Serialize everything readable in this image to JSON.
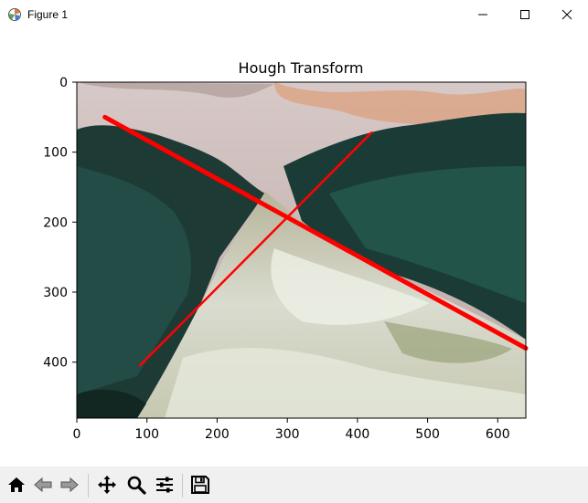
{
  "window": {
    "title": "Figure 1",
    "icons": [
      "matplotlib-figure-icon",
      "minimize-icon",
      "maximize-icon",
      "close-icon"
    ]
  },
  "figure": {
    "title": "Hough Transform"
  },
  "chart_data": {
    "type": "image",
    "title": "Hough Transform",
    "xlabel": "",
    "ylabel": "",
    "xlim": [
      0,
      640
    ],
    "ylim": [
      480,
      0
    ],
    "x_ticks": [
      "0",
      "100",
      "200",
      "300",
      "400",
      "500",
      "600"
    ],
    "y_ticks": [
      "0",
      "100",
      "200",
      "300",
      "400"
    ],
    "grid": false,
    "image_content": "photo of a white-water river between tree-lined banks under a cloudy sky",
    "overlay_lines": [
      {
        "color": "#ff0000",
        "x1": 40,
        "y1": 50,
        "x2": 640,
        "y2": 380
      },
      {
        "color": "#ff0000",
        "x1": 90,
        "y1": 405,
        "x2": 420,
        "y2": 72
      }
    ]
  },
  "toolbar": {
    "buttons": [
      "home-icon",
      "back-icon",
      "forward-icon",
      "pan-icon",
      "zoom-icon",
      "configure-subplots-icon",
      "save-icon"
    ]
  }
}
